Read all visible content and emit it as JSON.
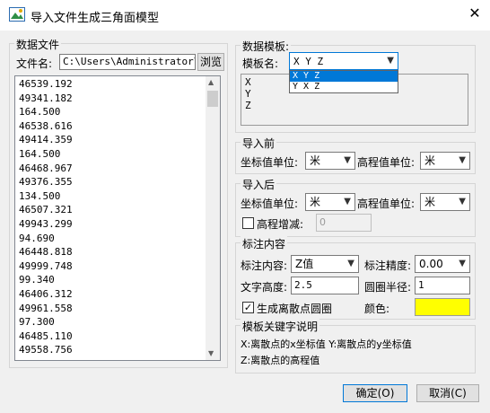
{
  "window": {
    "title": "导入文件生成三角面模型",
    "close_glyph": "✕"
  },
  "data_file": {
    "group_label": "数据文件",
    "file_label": "文件名:",
    "file_value": "C:\\Users\\Administrator\\D",
    "browse_label": "浏览",
    "values": [
      "46539.192",
      "49341.182",
      "164.500",
      "46538.616",
      "49414.359",
      "164.500",
      "46468.967",
      "49376.355",
      "134.500",
      "46507.321",
      "49943.299",
      "94.690",
      "46448.818",
      "49999.748",
      "99.340",
      "46406.312",
      "49961.558",
      "97.300",
      "46485.110",
      "49558.756"
    ]
  },
  "template": {
    "group_label": "数据模板:",
    "name_label": "模板名:",
    "selected": "X Y Z",
    "options": [
      "X Y Z",
      "Y X Z"
    ],
    "preview_lines": [
      "X",
      "Y",
      "Z"
    ]
  },
  "before_import": {
    "group_label": "导入前",
    "coord_unit_label": "坐标值单位:",
    "coord_unit": "米",
    "elev_unit_label": "高程值单位:",
    "elev_unit": "米"
  },
  "after_import": {
    "group_label": "导入后",
    "coord_unit_label": "坐标值单位:",
    "coord_unit": "米",
    "elev_unit_label": "高程值单位:",
    "elev_unit": "米",
    "elev_adjust_label": "高程增减:",
    "elev_adjust_value": "0",
    "elev_adjust_checked": false
  },
  "annotation": {
    "group_label": "标注内容",
    "content_label": "标注内容:",
    "content_value": "Z值",
    "precision_label": "标注精度:",
    "precision_value": "0.00",
    "text_height_label": "文字高度:",
    "text_height_value": "2.5",
    "circle_radius_label": "圆圈半径:",
    "circle_radius_value": "1",
    "gen_circle_label": "生成离散点圆圈",
    "gen_circle_checked": true,
    "color_label": "颜色:",
    "color_value": "#ffff00"
  },
  "keywords": {
    "group_label": "模板关键字说明",
    "line1": "X:离散点的x坐标值 Y:离散点的y坐标值",
    "line2": "Z:离散点的高程值"
  },
  "buttons": {
    "ok": "确定(O)",
    "cancel": "取消(C)"
  },
  "icons": {
    "dropdown": "▼",
    "check": "✓",
    "scroll_up": "▲",
    "scroll_down": "▼"
  }
}
